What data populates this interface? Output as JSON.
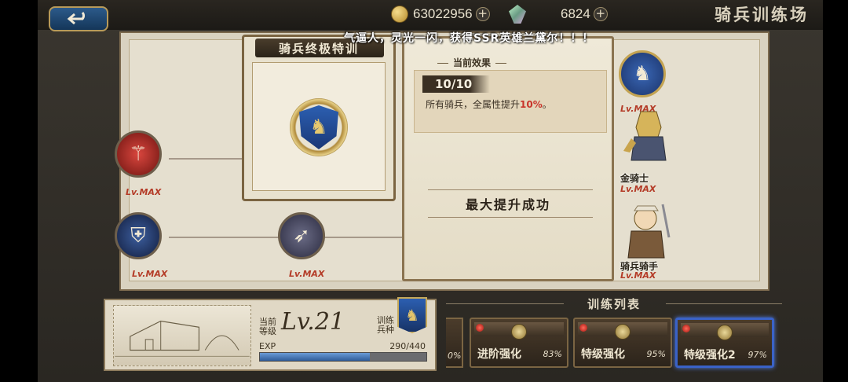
{
  "topbar": {
    "back_icon": "back-arrow-icon",
    "coins": "63022956",
    "gems": "6824",
    "title": "骑兵训练场"
  },
  "notice": "气逼人，灵光一闪，获得SSR英雄兰黛尔！！！",
  "card": {
    "title": "骑兵终极特训",
    "icon": "horse-shield-icon"
  },
  "effect": {
    "label": "当前效果",
    "level": "10/10",
    "desc_prefix": "所有骑兵，全属性提升",
    "desc_pct": "10%",
    "desc_suffix": "。",
    "success": "最大提升成功"
  },
  "tree": {
    "lv_max": "Lv.MAX",
    "lv_max_partial": "Lv.MAX",
    "hero_1_name": "金骑士",
    "hero_2_name": "骑兵骑手"
  },
  "info": {
    "current_label": "当前\n等级",
    "level": "Lv.21",
    "type_label": "训练\n兵种",
    "exp_label": "EXP",
    "exp_value": "290/440",
    "exp_progress": 0.659
  },
  "training_list": {
    "title": "训练列表",
    "partial_pct": "0%",
    "items": [
      {
        "name": "进阶强化",
        "pct": "83%"
      },
      {
        "name": "特级强化",
        "pct": "95%"
      },
      {
        "name": "特级强化2",
        "pct": "97%"
      }
    ]
  },
  "colors": {
    "accent_red": "#c9342a",
    "selected_border": "#3a62c7"
  }
}
